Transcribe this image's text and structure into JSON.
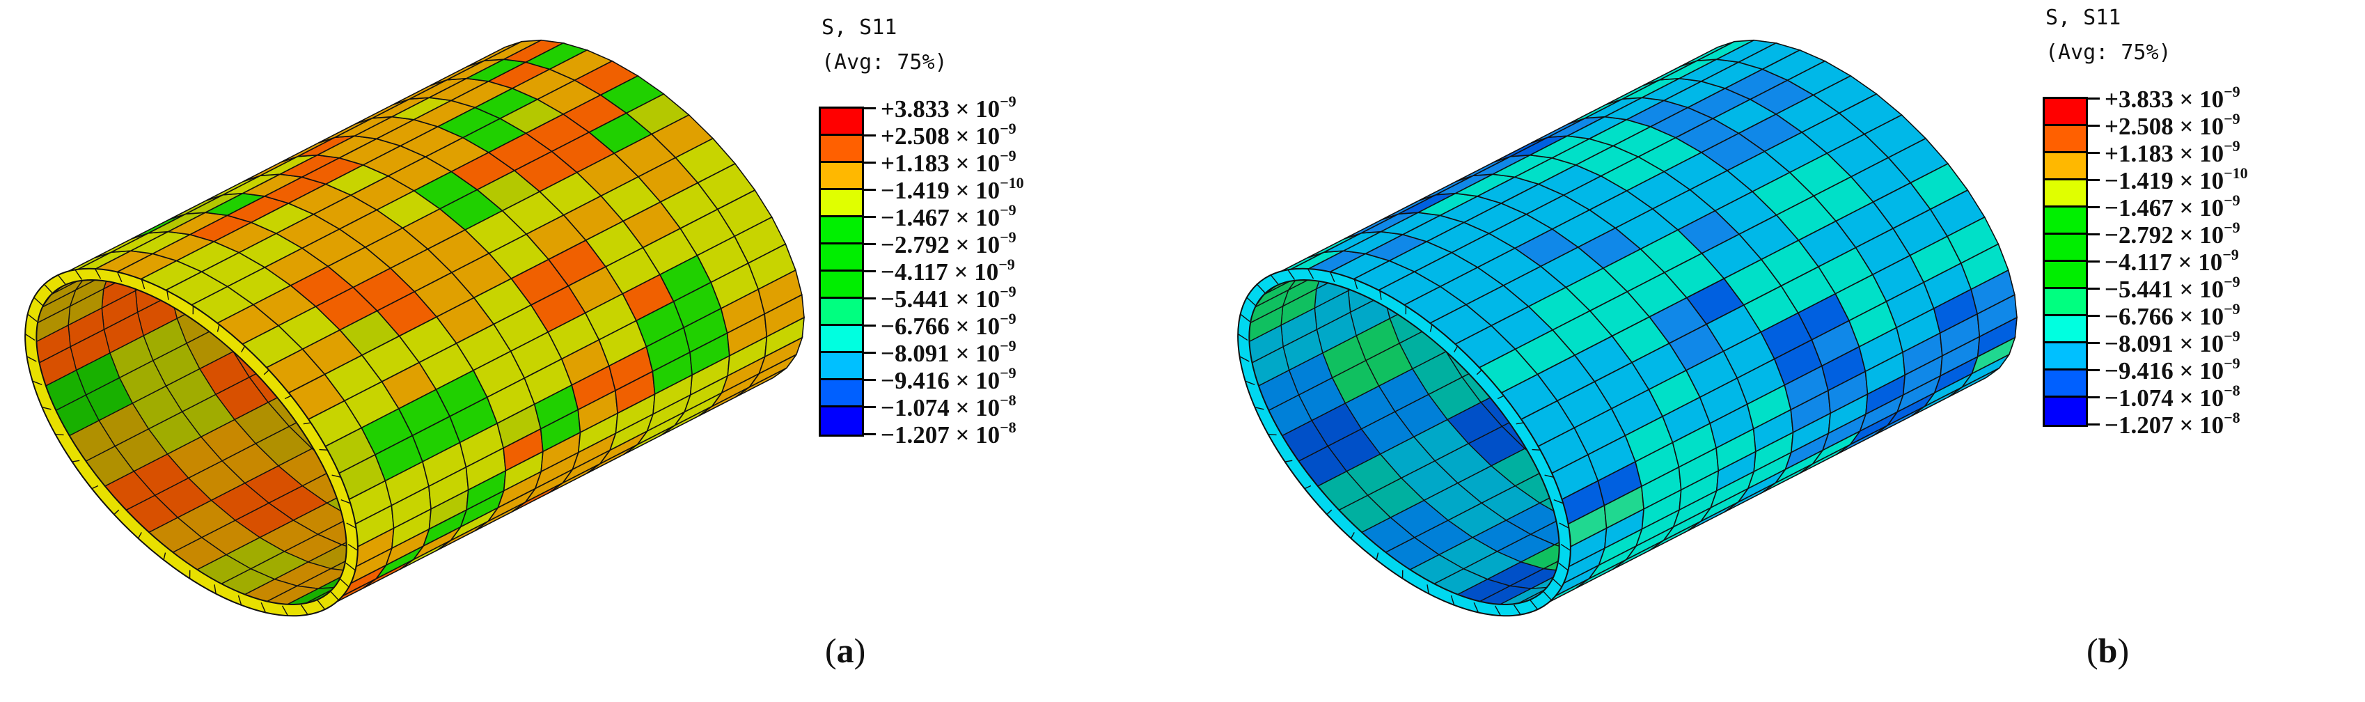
{
  "legend_colors": [
    "#ff0000",
    "#ff6000",
    "#ffb800",
    "#e0ff00",
    "#00f000",
    "#00ee00",
    "#00ee00",
    "#00ff80",
    "#00ffe0",
    "#00c0ff",
    "#0060ff",
    "#0000ff"
  ],
  "panels": [
    {
      "caption": "a",
      "legend": {
        "title": "S, S11",
        "subtitle": "(Avg: 75%)",
        "entries": [
          {
            "value": "+3.833 × 10",
            "exp": "−9"
          },
          {
            "value": "+2.508 × 10",
            "exp": "−9"
          },
          {
            "value": "+1.183 × 10",
            "exp": "−9"
          },
          {
            "value": "−1.419 × 10",
            "exp": "−10"
          },
          {
            "value": "−1.467 × 10",
            "exp": "−9"
          },
          {
            "value": "−2.792 × 10",
            "exp": "−9"
          },
          {
            "value": "−4.117 × 10",
            "exp": "−9"
          },
          {
            "value": "−5.441 × 10",
            "exp": "−9"
          },
          {
            "value": "−6.766 × 10",
            "exp": "−9"
          },
          {
            "value": "−8.091 × 10",
            "exp": "−9"
          },
          {
            "value": "−9.416 × 10",
            "exp": "−9"
          },
          {
            "value": "−1.074 × 10",
            "exp": "−8"
          },
          {
            "value": "−1.207 × 10",
            "exp": "−8"
          }
        ]
      },
      "palette_outer": [
        "#c8d400",
        "#c8d400",
        "#e0a000",
        "#e0a000",
        "#f06000",
        "#20d000",
        "#b4c800"
      ],
      "palette_inner": [
        "#a0ac00",
        "#c88800",
        "#d85000",
        "#18b000",
        "#b09000"
      ],
      "ring_color": "#e8e000"
    },
    {
      "caption": "b",
      "legend": {
        "title": "S, S11",
        "subtitle": "(Avg: 75%)",
        "entries": [
          {
            "value": "+3.833 × 10",
            "exp": "−9"
          },
          {
            "value": "+2.508 × 10",
            "exp": "−9"
          },
          {
            "value": "+1.183 × 10",
            "exp": "−9"
          },
          {
            "value": "−1.419 × 10",
            "exp": "−10"
          },
          {
            "value": "−1.467 × 10",
            "exp": "−9"
          },
          {
            "value": "−2.792 × 10",
            "exp": "−9"
          },
          {
            "value": "−4.117 × 10",
            "exp": "−9"
          },
          {
            "value": "−5.441 × 10",
            "exp": "−9"
          },
          {
            "value": "−6.766 × 10",
            "exp": "−9"
          },
          {
            "value": "−8.091 × 10",
            "exp": "−9"
          },
          {
            "value": "−9.416 × 10",
            "exp": "−9"
          },
          {
            "value": "−1.074 × 10",
            "exp": "−8"
          },
          {
            "value": "−1.207 × 10",
            "exp": "−8"
          }
        ]
      },
      "palette_outer": [
        "#00e0c8",
        "#00e0c8",
        "#00b8e8",
        "#00b8e8",
        "#1088e8",
        "#0060e0",
        "#20d890"
      ],
      "palette_inner": [
        "#00a8c8",
        "#0080d8",
        "#00b0a0",
        "#0050c8",
        "#10c060"
      ],
      "ring_color": "#00d8f0"
    }
  ]
}
